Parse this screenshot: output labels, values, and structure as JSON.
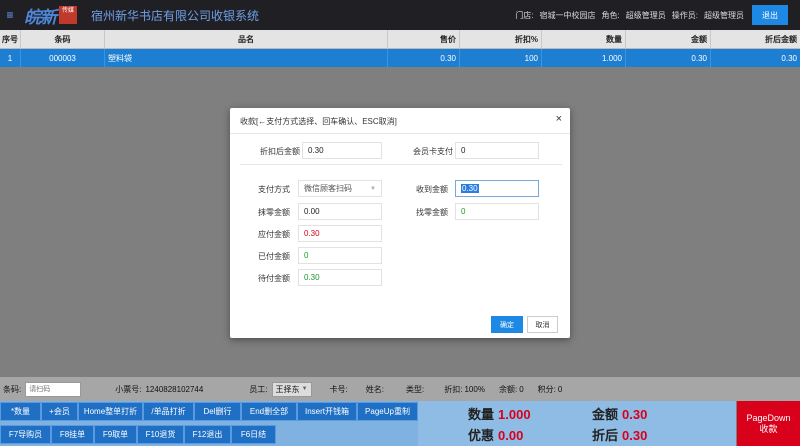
{
  "header": {
    "menu_icon": "≡",
    "logo_text": "皖新",
    "logo_badge": "传媒",
    "title": "宿州新华书店有限公司收银系统",
    "store_label": "门店:",
    "store_value": "宿城一中校园店",
    "role_label": "角色:",
    "role_value": "超级管理员",
    "operator_label": "操作员:",
    "operator_value": "超级管理员",
    "logout_label": "退出"
  },
  "table": {
    "columns": [
      "序号",
      "条码",
      "品名",
      "售价",
      "折扣%",
      "数量",
      "金额",
      "折后金额"
    ],
    "rows": [
      {
        "no": "1",
        "code": "000003",
        "name": "塑料袋",
        "price": "0.30",
        "discount": "100",
        "qty": "1.000",
        "amount": "0.30",
        "after": "0.30"
      }
    ]
  },
  "info_bar": {
    "barcode_label": "条码:",
    "barcode_placeholder": "请扫码",
    "ticket_label": "小票号:",
    "ticket_value": "1240828102744",
    "staff_label": "员工:",
    "staff_value": "王择东",
    "card_label": "卡号:",
    "name_label": "姓名:",
    "type_label": "类型:",
    "discount_label": "折扣:",
    "discount_value": "100%",
    "balance_label": "余额:",
    "balance_value": "0",
    "points_label": "积分:",
    "points_value": "0"
  },
  "fkeys": {
    "row1": [
      "*数量",
      "+会员",
      "Home整单打折",
      "/单品打折",
      "Del删行",
      "End删全部",
      "Insert开钱箱",
      "PageUp重制"
    ],
    "row2": [
      "F7导购员",
      "F8挂单",
      "F9取单",
      "F10退货",
      "F12退出",
      "F6日结"
    ]
  },
  "summary": {
    "qty_label": "数量",
    "qty_value": "1.000",
    "amount_label": "金额",
    "amount_value": "0.30",
    "discount_label": "优惠",
    "discount_value": "0.00",
    "after_label": "折后",
    "after_value": "0.30",
    "pagedown_line1": "PageDown",
    "pagedown_line2": "收款"
  },
  "modal": {
    "title": "收款[←支付方式选择、回车确认、ESC取消]",
    "close": "×",
    "after_discount_label": "折扣后金额",
    "after_discount_value": "0.30",
    "member_pay_label": "会员卡支付",
    "member_pay_value": "0",
    "pay_method_label": "支付方式",
    "pay_method_value": "微信顾客扫码",
    "received_label": "收到金额",
    "received_value": "0.30",
    "round_label": "抹零金额",
    "round_value": "0.00",
    "change_label": "找零金额",
    "change_value": "0",
    "due_label": "应付金额",
    "due_value": "0.30",
    "paid_label": "已付金额",
    "paid_value": "0",
    "pending_label": "待付金额",
    "pending_value": "0.30",
    "ok_label": "确定",
    "cancel_label": "取消"
  },
  "colors": {
    "header_bg": "#1f1f24",
    "accent": "#1e88e5",
    "selected_row": "#1e7fd2",
    "alert_red": "#d9001b",
    "positive_green": "#1a9c2b"
  }
}
